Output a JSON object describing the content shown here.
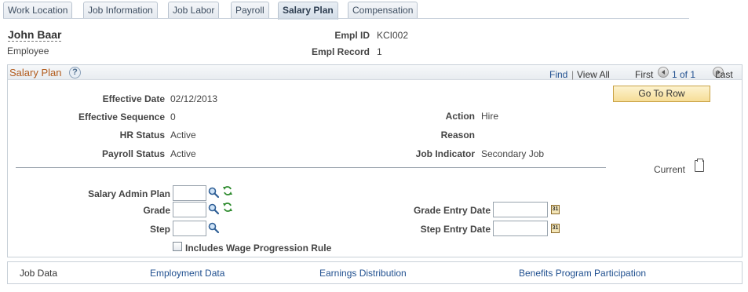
{
  "tabs": [
    {
      "label": "Work Location",
      "active": false
    },
    {
      "label": "Job Information",
      "active": false
    },
    {
      "label": "Job Labor",
      "active": false
    },
    {
      "label": "Payroll",
      "active": false
    },
    {
      "label": "Salary Plan",
      "active": true
    },
    {
      "label": "Compensation",
      "active": false
    }
  ],
  "header": {
    "employee_name": "John Baar",
    "employee_type": "Employee",
    "empl_id_label": "Empl ID",
    "empl_id": "KCI002",
    "empl_record_label": "Empl Record",
    "empl_record": "1"
  },
  "panel": {
    "title": "Salary Plan",
    "help_glyph": "?",
    "find": "Find",
    "separator": "|",
    "view_all": "View All",
    "first": "First",
    "range": "1 of 1",
    "last": "Last",
    "go_to_row": "Go To Row",
    "current": "Current"
  },
  "fields": {
    "effective_date_label": "Effective Date",
    "effective_date": "02/12/2013",
    "effective_sequence_label": "Effective Sequence",
    "effective_sequence": "0",
    "hr_status_label": "HR Status",
    "hr_status": "Active",
    "payroll_status_label": "Payroll Status",
    "payroll_status": "Active",
    "action_label": "Action",
    "action": "Hire",
    "reason_label": "Reason",
    "reason": "",
    "job_indicator_label": "Job Indicator",
    "job_indicator": "Secondary Job"
  },
  "form": {
    "salary_admin_plan_label": "Salary Admin Plan",
    "salary_admin_plan": "",
    "grade_label": "Grade",
    "grade": "",
    "step_label": "Step",
    "step": "",
    "grade_entry_date_label": "Grade Entry Date",
    "grade_entry_date": "",
    "step_entry_date_label": "Step Entry Date",
    "step_entry_date": "",
    "wage_progression_label": "Includes Wage Progression Rule",
    "calendar_glyph": "31"
  },
  "footer": {
    "job_data": "Job Data",
    "employment_data": "Employment Data",
    "earnings_distribution": "Earnings Distribution",
    "benefits_program": "Benefits Program Participation"
  },
  "colors": {
    "panel_title": "#b25b1c",
    "link": "#1f4f8f",
    "button_bg": "#f6dd97",
    "refresh_green": "#2e8b2e"
  }
}
